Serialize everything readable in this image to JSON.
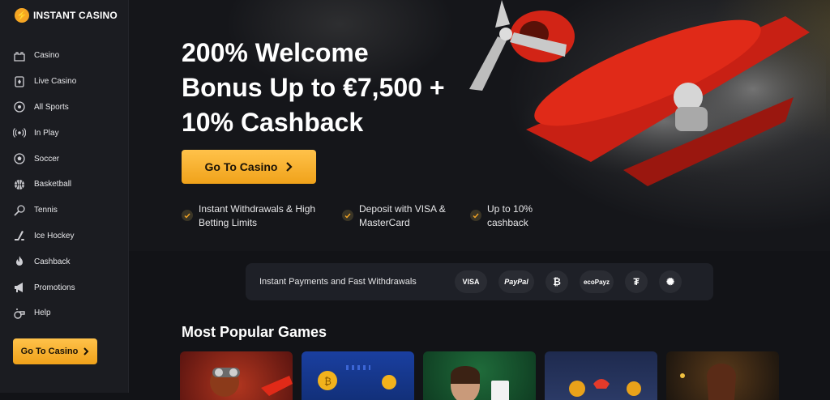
{
  "brand": {
    "name": "INSTANT CASINO",
    "mark": "⚡"
  },
  "sidebar": {
    "items": [
      {
        "label": "Casino",
        "icon": "castle-icon"
      },
      {
        "label": "Live Casino",
        "icon": "card-icon"
      },
      {
        "label": "All Sports",
        "icon": "ball-icon"
      },
      {
        "label": "In Play",
        "icon": "broadcast-icon"
      },
      {
        "label": "Soccer",
        "icon": "soccer-icon"
      },
      {
        "label": "Basketball",
        "icon": "basketball-icon"
      },
      {
        "label": "Tennis",
        "icon": "tennis-icon"
      },
      {
        "label": "Ice Hockey",
        "icon": "hockey-icon"
      },
      {
        "label": "Cashback",
        "icon": "flame-icon"
      },
      {
        "label": "Promotions",
        "icon": "megaphone-icon"
      },
      {
        "label": "Help",
        "icon": "whistle-icon"
      }
    ],
    "cta_label": "Go To Casino"
  },
  "hero": {
    "title_line1": "200% Welcome",
    "title_line2": "Bonus Up to €7,500 +",
    "title_line3": "10% Cashback",
    "cta_label": "Go To Casino",
    "perks": [
      {
        "line1": "Instant Withdrawals & High",
        "line2": "Betting Limits"
      },
      {
        "line1": "Deposit with VISA &",
        "line2": "MasterCard"
      },
      {
        "line1": "Up to 10%",
        "line2": "cashback"
      }
    ]
  },
  "payments": {
    "text": "Instant Payments and Fast Withdrawals",
    "badges": [
      {
        "label": "VISA",
        "icon": "visa-icon"
      },
      {
        "label": "PayPal",
        "icon": "paypal-icon"
      },
      {
        "label": "₿",
        "icon": "bitcoin-icon"
      },
      {
        "label": "ecoPayz",
        "icon": "ecopayz-icon"
      },
      {
        "label": "₮",
        "icon": "tether-icon"
      },
      {
        "label": "✺",
        "icon": "cardano-icon"
      }
    ]
  },
  "games": {
    "title": "Most Popular Games"
  },
  "colors": {
    "accent": "#f5a524",
    "bg": "#121317",
    "sidebar": "#1b1c21"
  }
}
